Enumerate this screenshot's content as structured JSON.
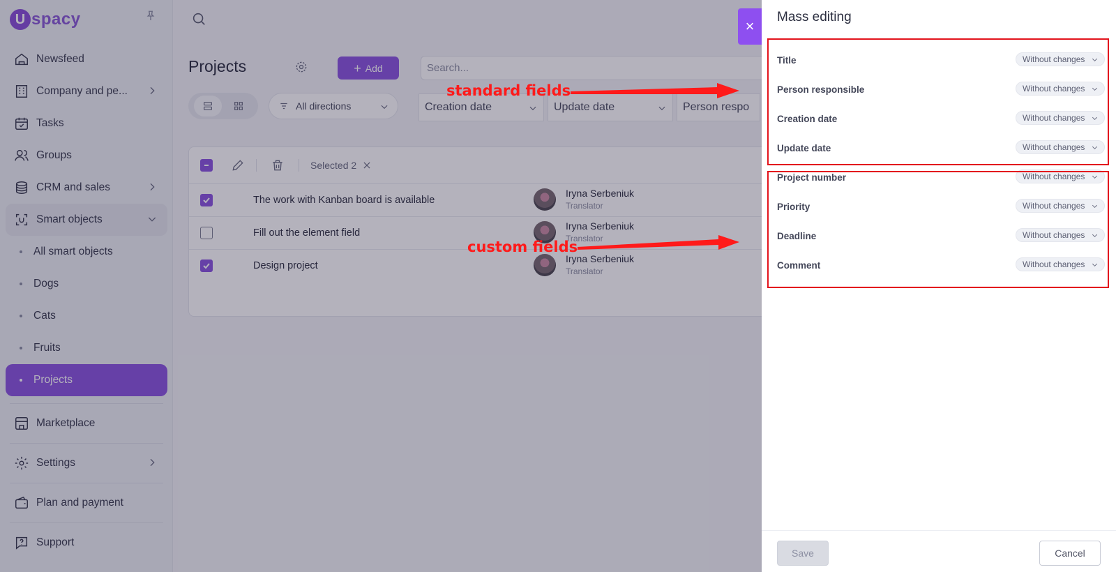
{
  "app": {
    "logo_letter": "U",
    "logo_text": "spacy"
  },
  "sidebar": {
    "items": [
      {
        "label": "Newsfeed",
        "icon": "home-icon"
      },
      {
        "label": "Company and pe...",
        "icon": "building-icon"
      },
      {
        "label": "Tasks",
        "icon": "calendar-check-icon"
      },
      {
        "label": "Groups",
        "icon": "users-icon"
      },
      {
        "label": "CRM and sales",
        "icon": "coins-icon"
      },
      {
        "label": "Smart objects",
        "icon": "scan-icon"
      }
    ],
    "sub_items": [
      {
        "label": "All smart objects"
      },
      {
        "label": "Dogs"
      },
      {
        "label": "Cats"
      },
      {
        "label": "Fruits"
      },
      {
        "label": "Projects"
      }
    ],
    "bottom_items": [
      {
        "label": "Marketplace",
        "icon": "store-icon"
      },
      {
        "label": "Settings",
        "icon": "gear-icon"
      },
      {
        "label": "Plan and payment",
        "icon": "wallet-icon"
      },
      {
        "label": "Support",
        "icon": "help-icon"
      }
    ]
  },
  "main": {
    "title": "Projects",
    "add_label": "Add",
    "search_placeholder": "Search...",
    "directions_label": "All directions",
    "filters": [
      "Creation date",
      "Update date",
      "Person respo"
    ],
    "selected_label": "Selected 2",
    "rows": [
      {
        "title": "The work with Kanban board is available",
        "person": "Iryna Serbeniuk",
        "role": "Translator",
        "checked": true
      },
      {
        "title": "Fill out the element field",
        "person": "Iryna Serbeniuk",
        "role": "Translator",
        "checked": false
      },
      {
        "title": "Design project",
        "person": "Iryna Serbeniuk",
        "role": "Translator",
        "checked": true
      }
    ]
  },
  "panel": {
    "title": "Mass editing",
    "close_label": "×",
    "fields": [
      {
        "label": "Title",
        "value": "Without changes"
      },
      {
        "label": "Person responsible",
        "value": "Without changes"
      },
      {
        "label": "Creation date",
        "value": "Without changes"
      },
      {
        "label": "Update date",
        "value": "Without changes"
      },
      {
        "label": "Project number",
        "value": "Without changes"
      },
      {
        "label": "Priority",
        "value": "Without changes"
      },
      {
        "label": "Deadline",
        "value": "Without changes"
      },
      {
        "label": "Comment",
        "value": "Without changes"
      }
    ],
    "save_label": "Save",
    "cancel_label": "Cancel"
  },
  "annotations": {
    "standard": "standard fields",
    "custom": "custom fields",
    "color": "#ff1a1a"
  },
  "colors": {
    "accent": "#8b55e0",
    "highlight": "#e3141d"
  }
}
